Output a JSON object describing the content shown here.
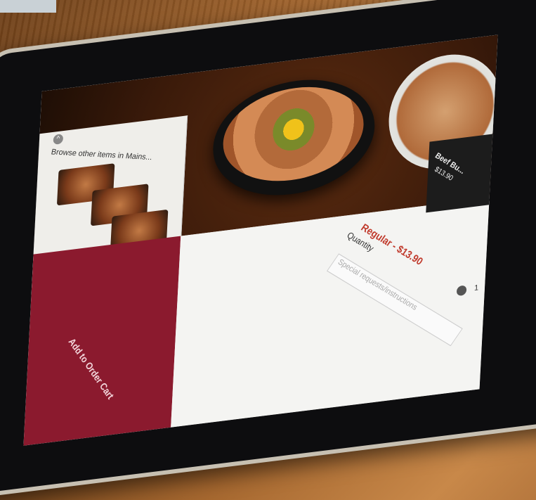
{
  "menu_panel": {
    "browse_text": "Browse other items in Mains...",
    "back_icon": "chevron-up-icon",
    "confirm_icon": "checkmark-icon"
  },
  "item_detail": {
    "price_label": "Regular - $13.90",
    "quantity_label": "Quantity",
    "special_request_placeholder": "Special requests/instructions",
    "quantity_value": "1"
  },
  "cart": {
    "add_label": "Add to Order Cart",
    "accent_color": "#8b1a2e"
  },
  "side_item": {
    "title": "Beef Bu...",
    "price": "$13.90"
  }
}
